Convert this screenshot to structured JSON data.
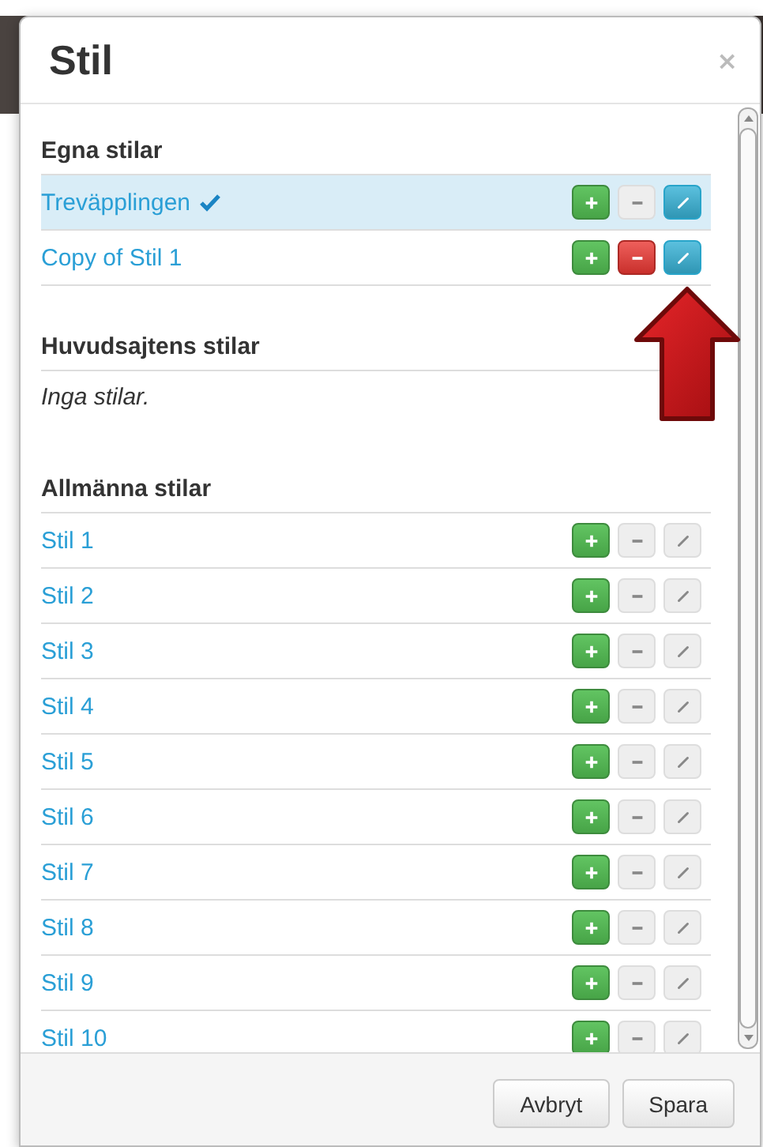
{
  "dialog": {
    "title": "Stil",
    "close": "×"
  },
  "sections": [
    {
      "heading": "Egna stilar",
      "items": [
        {
          "name": "Treväpplingen",
          "selected": true,
          "current": true,
          "delete_enabled": false,
          "edit_enabled": true
        },
        {
          "name": "Copy of Stil 1",
          "selected": false,
          "current": false,
          "delete_enabled": true,
          "edit_enabled": true
        }
      ]
    },
    {
      "heading": "Huvudsajtens stilar",
      "empty_text": "Inga stilar."
    },
    {
      "heading": "Allmänna stilar",
      "items": [
        {
          "name": "Stil 1",
          "selected": false,
          "current": false,
          "delete_enabled": false,
          "edit_enabled": false
        },
        {
          "name": "Stil 2",
          "selected": false,
          "current": false,
          "delete_enabled": false,
          "edit_enabled": false
        },
        {
          "name": "Stil 3",
          "selected": false,
          "current": false,
          "delete_enabled": false,
          "edit_enabled": false
        },
        {
          "name": "Stil 4",
          "selected": false,
          "current": false,
          "delete_enabled": false,
          "edit_enabled": false
        },
        {
          "name": "Stil 5",
          "selected": false,
          "current": false,
          "delete_enabled": false,
          "edit_enabled": false
        },
        {
          "name": "Stil 6",
          "selected": false,
          "current": false,
          "delete_enabled": false,
          "edit_enabled": false
        },
        {
          "name": "Stil 7",
          "selected": false,
          "current": false,
          "delete_enabled": false,
          "edit_enabled": false
        },
        {
          "name": "Stil 8",
          "selected": false,
          "current": false,
          "delete_enabled": false,
          "edit_enabled": false
        },
        {
          "name": "Stil 9",
          "selected": false,
          "current": false,
          "delete_enabled": false,
          "edit_enabled": false
        },
        {
          "name": "Stil 10",
          "selected": false,
          "current": false,
          "delete_enabled": false,
          "edit_enabled": false
        }
      ]
    }
  ],
  "buttons": [
    {
      "label": "Avbryt"
    },
    {
      "label": "Spara"
    }
  ]
}
